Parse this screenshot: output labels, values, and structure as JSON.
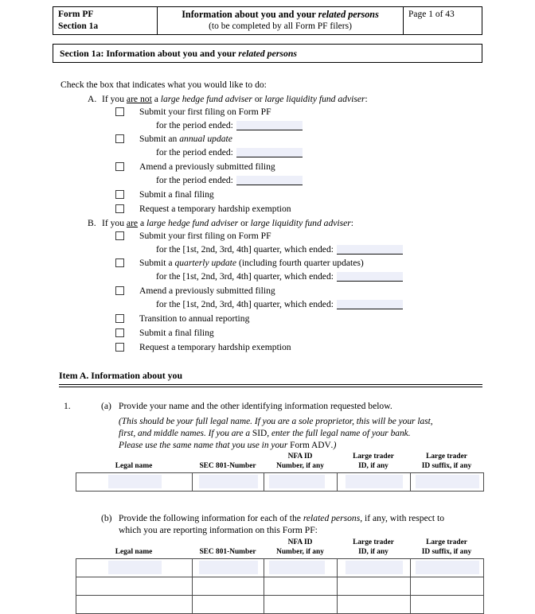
{
  "header": {
    "form_name": "Form PF",
    "section_name": "Section 1a",
    "title_line1": "Information about you and your related persons",
    "title_line1_plain": "Information about you and your ",
    "title_line1_italic": "related persons",
    "title_line2": "(to be completed by all Form PF filers)",
    "page_label": "Page 1 of 43"
  },
  "section_bar": {
    "prefix": "Section 1a:  Information about you and your ",
    "italic": "related persons"
  },
  "instruction": "Check the box that indicates what you would like to do:",
  "group_a": {
    "letter": "A.",
    "text_pre": "If you ",
    "text_underline": "are not",
    "text_mid": " a ",
    "italic_1": "large hedge fund adviser",
    "text_or": " or ",
    "italic_2": "large liquidity fund adviser",
    "text_end": ":",
    "options": [
      {
        "label": "Submit your first filing on Form PF",
        "sub_label": "for the period ended:",
        "has_field": true
      },
      {
        "label_pre": "Submit an ",
        "label_italic": "annual update",
        "label_post": "",
        "sub_label": "for the period ended:",
        "has_field": true
      },
      {
        "label": "Amend a previously submitted filing",
        "sub_label": "for the period ended:",
        "has_field": true
      },
      {
        "label": "Submit a final filing",
        "has_field": false
      },
      {
        "label": "Request a temporary hardship exemption",
        "has_field": false
      }
    ]
  },
  "group_b": {
    "letter": "B.",
    "text_pre": "If you ",
    "text_underline": "are",
    "text_mid": " a ",
    "italic_1": "large hedge fund adviser",
    "text_or": " or ",
    "italic_2": "large liquidity fund adviser",
    "text_end": ":",
    "options": [
      {
        "label": "Submit your first filing on Form PF",
        "sub_label": "for the [1st, 2nd, 3rd, 4th] quarter, which ended:",
        "has_field": true
      },
      {
        "label_pre": "Submit a ",
        "label_italic": "quarterly update",
        "label_post": " (including fourth quarter updates)",
        "sub_label": "for the [1st, 2nd, 3rd, 4th] quarter, which ended:",
        "has_field": true
      },
      {
        "label": "Amend a previously submitted filing",
        "sub_label": "for the [1st, 2nd, 3rd, 4th] quarter, which ended:",
        "has_field": true
      },
      {
        "label": "Transition to annual reporting",
        "has_field": false
      },
      {
        "label": "Submit a final filing",
        "has_field": false
      },
      {
        "label": "Request a temporary hardship exemption",
        "has_field": false
      }
    ]
  },
  "item_a": {
    "heading": "Item A.  Information about you"
  },
  "question_1": {
    "number": "1.",
    "part_a_marker": "(a)",
    "part_a_text": "Provide your name and the other identifying information requested below.",
    "note_line1_pre": "(This should be your full legal name.  If you are a sole proprietor, this will be your last,",
    "note_line2_pre": "first, and middle names.  If you are a ",
    "note_line2_roman": "SID",
    "note_line2_post": ", enter the full legal name of your bank.",
    "note_line3_pre": "Please use the same name that you use in your ",
    "note_line3_roman": "Form ADV",
    "note_line3_post": ".)",
    "part_b_marker": "(b)",
    "part_b_line1_pre": "Provide the following information for each of the ",
    "part_b_line1_italic": "related persons",
    "part_b_line1_post": ", if any, with respect to",
    "part_b_line2": "which you are reporting information on this Form PF:"
  },
  "table_columns": [
    {
      "line1": "",
      "line2": "Legal name"
    },
    {
      "line1": "",
      "line2": "SEC 801-Number"
    },
    {
      "line1": "NFA ID",
      "line2": "Number, if any"
    },
    {
      "line1": "Large trader",
      "line2": "ID, if any"
    },
    {
      "line1": "Large trader",
      "line2": "ID suffix, if any"
    }
  ],
  "table_a": {
    "rows": 1,
    "values": [
      [
        "",
        "",
        "",
        "",
        ""
      ]
    ]
  },
  "table_b": {
    "rows": 3,
    "values": [
      [
        "",
        "",
        "",
        "",
        ""
      ],
      [
        "",
        "",
        "",
        "",
        ""
      ],
      [
        "",
        "",
        "",
        "",
        ""
      ]
    ]
  },
  "colors": {
    "field_fill": "#edeff9",
    "border": "#000000",
    "table_border": "#4a4a4a",
    "page_bg": "#ffffff"
  }
}
